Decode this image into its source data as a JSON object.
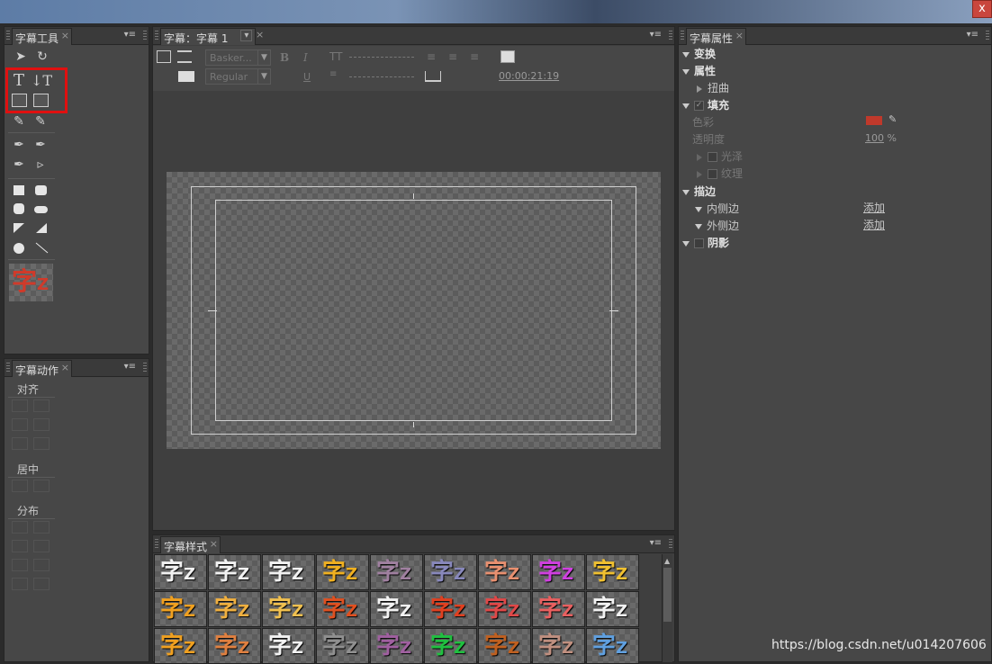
{
  "window": {
    "close_glyph": "x"
  },
  "tools_panel": {
    "tab_label": "字幕工具",
    "close_glyph": "×",
    "menu_glyph": "▾≡",
    "text_tool": "T",
    "vertical_text_tool": "↓T",
    "preview_char": "字",
    "preview_latin": "Z"
  },
  "actions_panel": {
    "tab_label": "字幕动作",
    "close_glyph": "×",
    "menu_glyph": "▾≡",
    "align_label": "对齐",
    "center_label": "居中",
    "distribute_label": "分布"
  },
  "titler_panel": {
    "tab_label": "字幕：字幕 1",
    "dropdown_glyph": "▾",
    "close_glyph": "×",
    "menu_glyph": "▾≡",
    "font_family": "Basker...",
    "font_style": "Regular",
    "bold": "B",
    "italic": "I",
    "underline": "U",
    "timecode": "00:00:21:19"
  },
  "styles_panel": {
    "tab_label": "字幕样式",
    "close_glyph": "×",
    "menu_glyph": "▾≡",
    "char": "字",
    "latin": "Z",
    "cells": [
      {
        "color": "#f2f2f2"
      },
      {
        "color": "#f2f2f2"
      },
      {
        "color": "#f2f2f2"
      },
      {
        "color": "#f0b020"
      },
      {
        "color": "#a080a0"
      },
      {
        "color": "#8888bb"
      },
      {
        "color": "#e89070"
      },
      {
        "color": "#d040e0"
      },
      {
        "color": "#f0c030"
      },
      {
        "color": "#f0a020"
      },
      {
        "color": "#f0b040"
      },
      {
        "color": "#f0c050"
      },
      {
        "color": "#e05020"
      },
      {
        "color": "#f2f2f2"
      },
      {
        "color": "#e04020"
      },
      {
        "color": "#e04848"
      },
      {
        "color": "#e86060"
      },
      {
        "color": "#f2f2f2"
      },
      {
        "color": "#f0a020"
      },
      {
        "color": "#e08040"
      },
      {
        "color": "#f2f2f2"
      },
      {
        "color": "#909090"
      },
      {
        "color": "#a060a0"
      },
      {
        "color": "#20c040"
      },
      {
        "color": "#c06020"
      },
      {
        "color": "#c09080"
      },
      {
        "color": "#60a0e0"
      }
    ]
  },
  "properties_panel": {
    "tab_label": "字幕属性",
    "close_glyph": "×",
    "menu_glyph": "▾≡",
    "transform": "变换",
    "properties": "属性",
    "distort": "扭曲",
    "fill": "填充",
    "color_label": "色彩",
    "fill_color": "#c0392b",
    "opacity_label": "透明度",
    "opacity_value": "100",
    "opacity_unit": "%",
    "sheen": "光泽",
    "texture": "纹理",
    "stroke": "描边",
    "inner_stroke": "内侧边",
    "outer_stroke": "外侧边",
    "add_label": "添加",
    "shadow": "阴影"
  },
  "watermark": "https://blog.csdn.net/u014207606"
}
